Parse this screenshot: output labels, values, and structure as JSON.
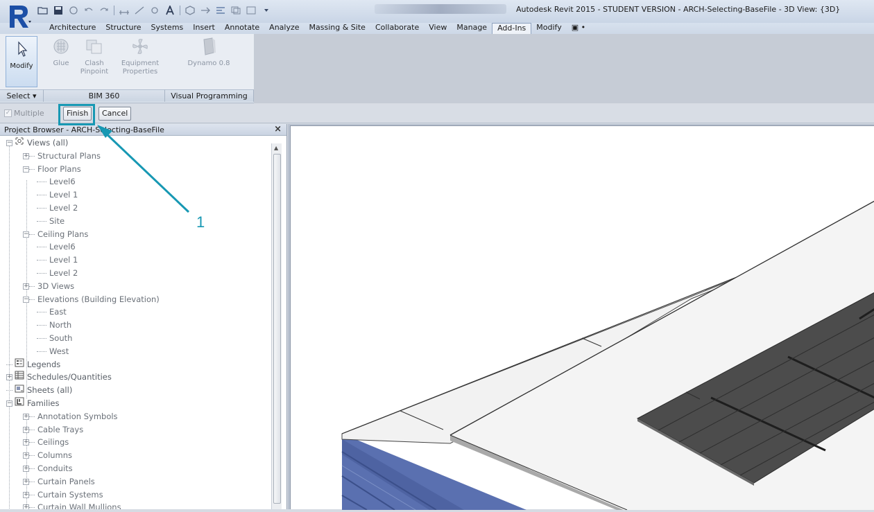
{
  "window": {
    "title": "Autodesk Revit 2015 - STUDENT VERSION -    ARCH-Selecting-BaseFile - 3D View: {3D}"
  },
  "ribbon_tabs": [
    "Architecture",
    "Structure",
    "Systems",
    "Insert",
    "Annotate",
    "Analyze",
    "Massing & Site",
    "Collaborate",
    "View",
    "Manage",
    "Add-Ins",
    "Modify",
    "▣ •"
  ],
  "active_tab": "Add-Ins",
  "ribbon": {
    "modify_label": "Modify",
    "glue_label": "Glue",
    "clash_label": "Clash\nPinpoint",
    "equipment_label": "Equipment\nProperties",
    "dynamo_label": "Dynamo 0.8",
    "panel_select": "Select ▾",
    "panel_bim360": "BIM 360",
    "panel_visual": "Visual Programming"
  },
  "options_bar": {
    "multiple_label": "Multiple",
    "finish_label": "Finish",
    "cancel_label": "Cancel"
  },
  "project_browser": {
    "title": "Project Browser - ARCH-Selecting-BaseFile",
    "close": "×",
    "tree": [
      {
        "label": "Views (all)",
        "expander": "−",
        "icon": "views-icon"
      },
      {
        "label": "Structural Plans",
        "expander": "+"
      },
      {
        "label": "Floor Plans",
        "expander": "−"
      },
      {
        "label": "Level6"
      },
      {
        "label": "Level 1"
      },
      {
        "label": "Level 2"
      },
      {
        "label": "Site"
      },
      {
        "label": "Ceiling Plans",
        "expander": "−"
      },
      {
        "label": "Level6"
      },
      {
        "label": "Level 1"
      },
      {
        "label": "Level 2"
      },
      {
        "label": "3D Views",
        "expander": "+"
      },
      {
        "label": "Elevations (Building Elevation)",
        "expander": "−"
      },
      {
        "label": "East"
      },
      {
        "label": "North"
      },
      {
        "label": "South"
      },
      {
        "label": "West"
      },
      {
        "label": "Legends",
        "icon": "legends-icon"
      },
      {
        "label": "Schedules/Quantities",
        "expander": "+",
        "icon": "schedules-icon"
      },
      {
        "label": "Sheets (all)",
        "icon": "sheets-icon"
      },
      {
        "label": "Families",
        "expander": "−",
        "icon": "families-icon"
      },
      {
        "label": "Annotation Symbols",
        "expander": "+"
      },
      {
        "label": "Cable Trays",
        "expander": "+"
      },
      {
        "label": "Ceilings",
        "expander": "+"
      },
      {
        "label": "Columns",
        "expander": "+"
      },
      {
        "label": "Conduits",
        "expander": "+"
      },
      {
        "label": "Curtain Panels",
        "expander": "+"
      },
      {
        "label": "Curtain Systems",
        "expander": "+"
      },
      {
        "label": "Curtain Wall Mullions",
        "expander": "+"
      }
    ]
  },
  "annotation": {
    "callout_number": "1",
    "color": "#1798b3"
  },
  "colors": {
    "accent_blue_wall": "#5a70b0",
    "roof_dark": "#4a4a4a"
  }
}
